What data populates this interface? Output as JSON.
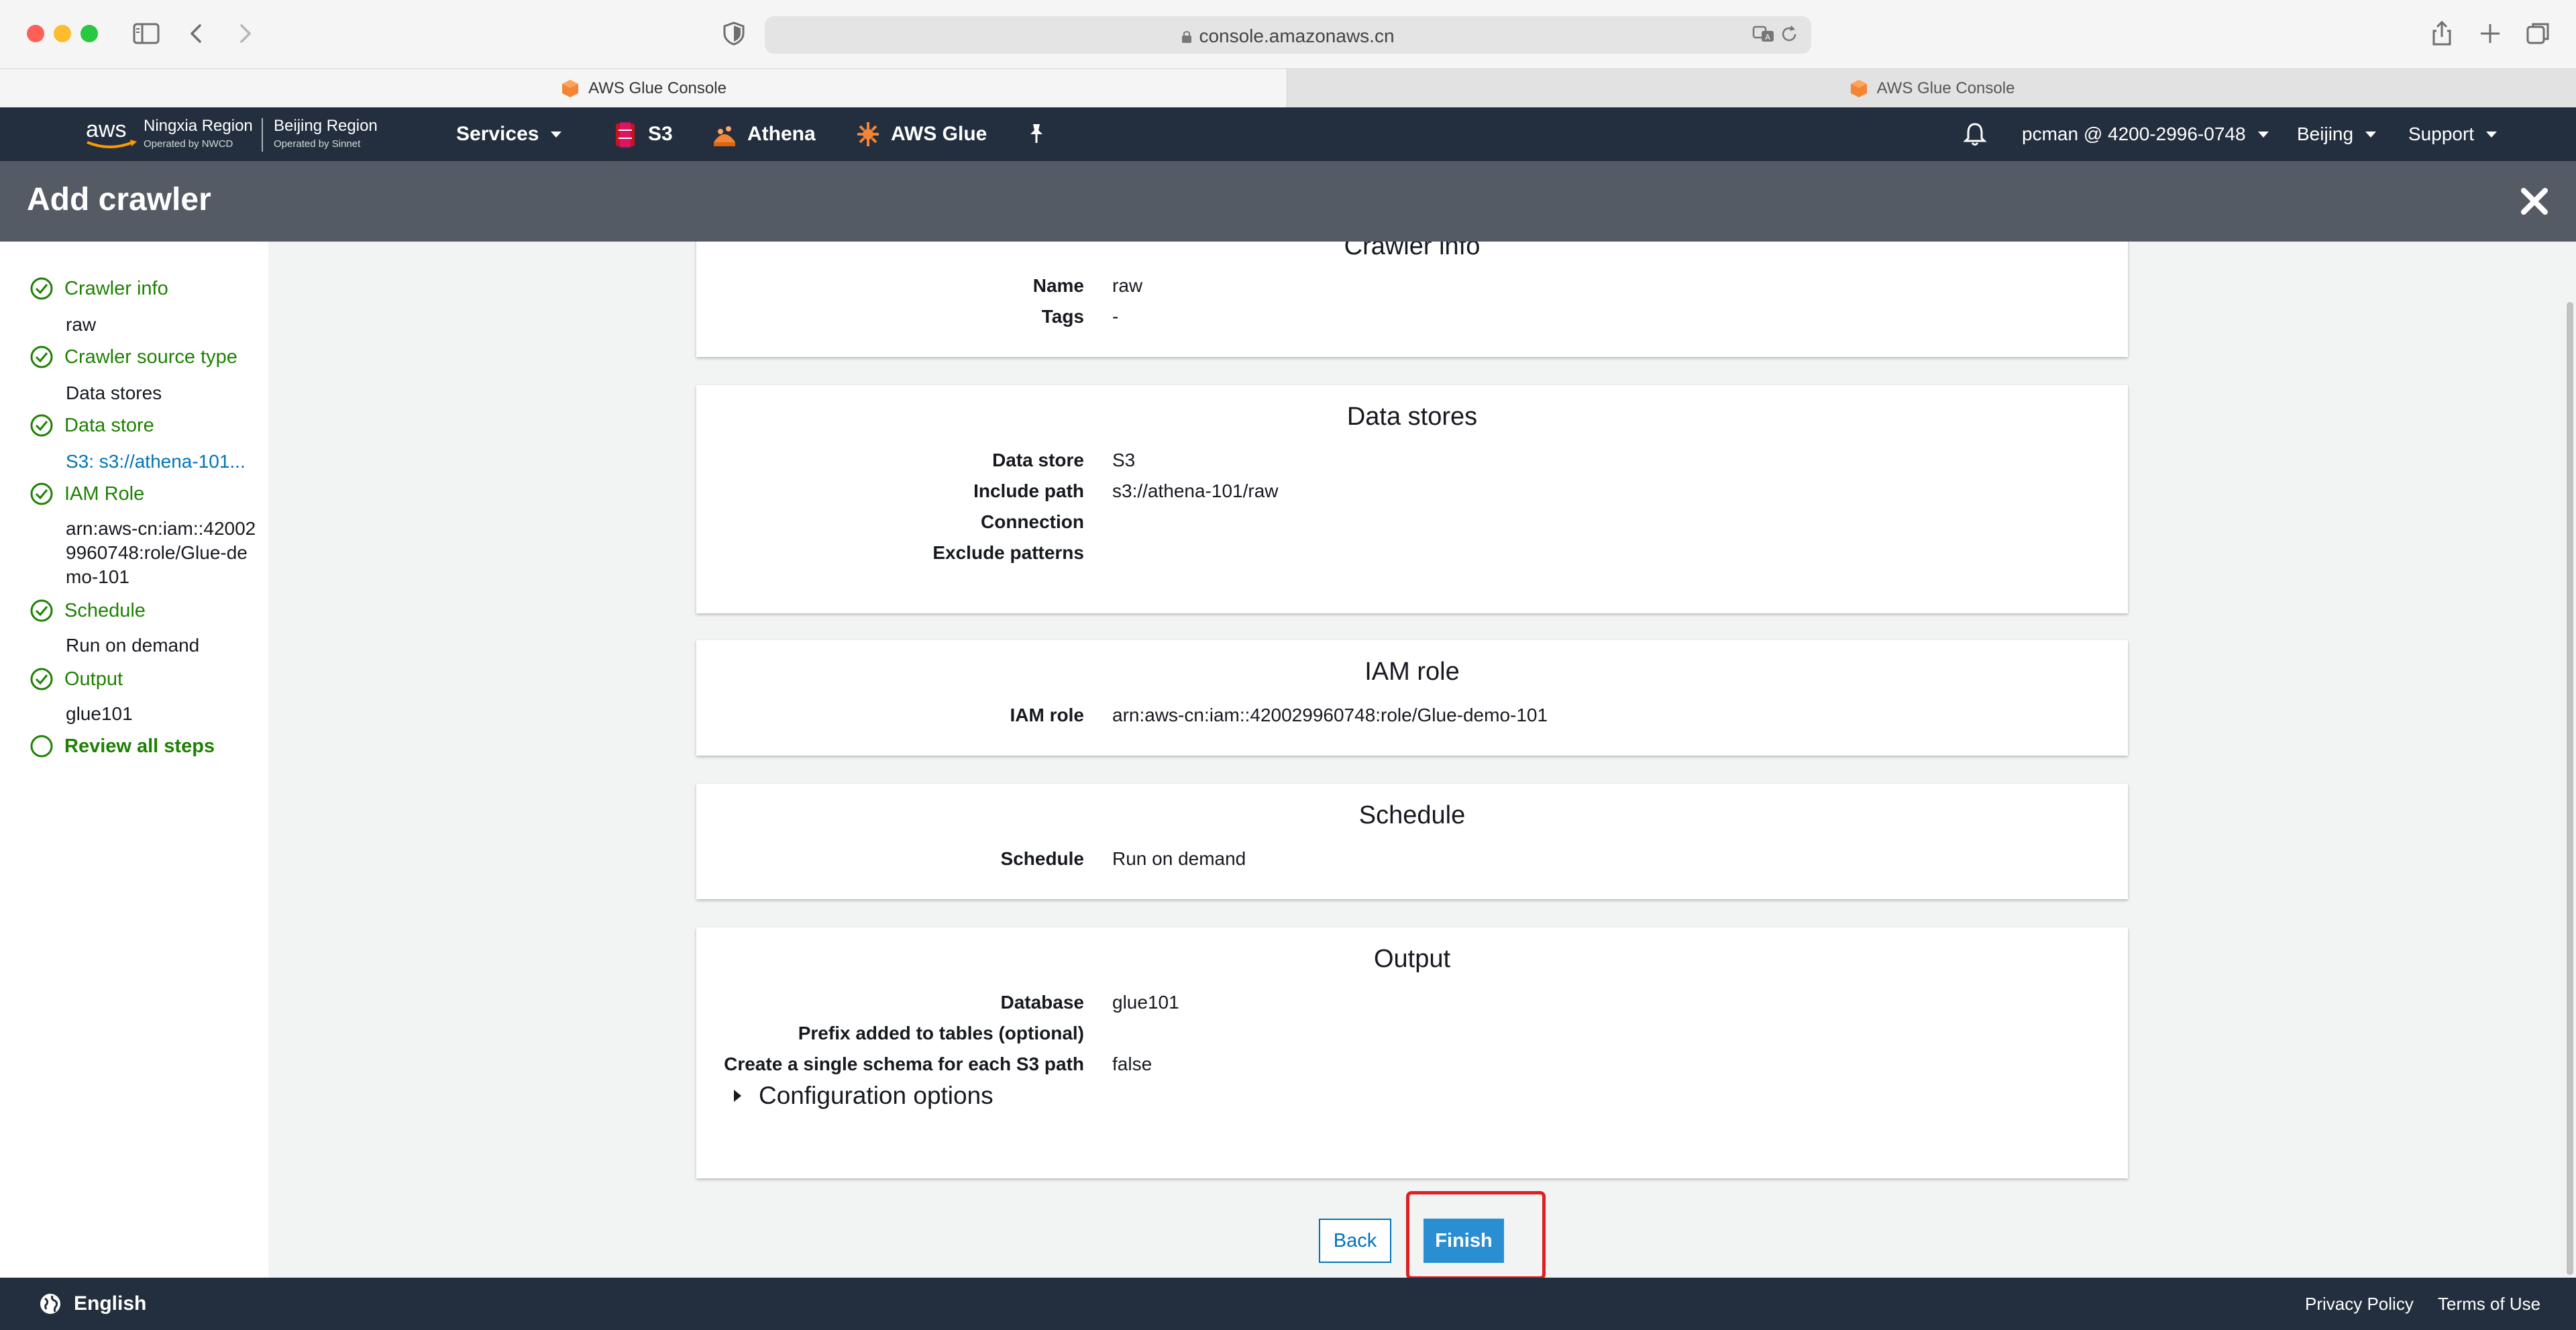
{
  "browser": {
    "url": "console.amazonaws.cn",
    "tabs": [
      {
        "label": "AWS Glue Console"
      },
      {
        "label": "AWS Glue Console"
      }
    ]
  },
  "nav": {
    "region_1": {
      "name": "Ningxia Region",
      "operator": "Operated by NWCD"
    },
    "region_2": {
      "name": "Beijing Region",
      "operator": "Operated by Sinnet"
    },
    "services": "Services",
    "s3": "S3",
    "athena": "Athena",
    "glue": "AWS Glue",
    "account": "pcman @ 4200-2996-0748",
    "region": "Beijing",
    "support": "Support"
  },
  "page": {
    "title": "Add crawler"
  },
  "sidebar": {
    "steps": [
      {
        "label": "Crawler info",
        "value": "raw",
        "done": true
      },
      {
        "label": "Crawler source type",
        "value": "Data stores",
        "done": true
      },
      {
        "label": "Data store",
        "value": "S3: s3://athena-101...",
        "done": true
      },
      {
        "label": "IAM Role",
        "value": "arn:aws-cn:iam::420029960748:role/Glue-demo-101",
        "done": true
      },
      {
        "label": "Schedule",
        "value": "Run on demand",
        "done": true
      },
      {
        "label": "Output",
        "value": "glue101",
        "done": true
      },
      {
        "label": "Review all steps",
        "value": "",
        "done": false
      }
    ]
  },
  "review": {
    "crawler_info": {
      "title": "Crawler info",
      "name_label": "Name",
      "name_value": "raw",
      "tags_label": "Tags",
      "tags_value": "-"
    },
    "data_stores": {
      "title": "Data stores",
      "data_store_label": "Data store",
      "data_store_value": "S3",
      "include_path_label": "Include path",
      "include_path_value": "s3://athena-101/raw",
      "connection_label": "Connection",
      "connection_value": "",
      "exclude_label": "Exclude patterns",
      "exclude_value": ""
    },
    "iam_role": {
      "title": "IAM role",
      "label": "IAM role",
      "value": "arn:aws-cn:iam::420029960748:role/Glue-demo-101"
    },
    "schedule": {
      "title": "Schedule",
      "label": "Schedule",
      "value": "Run on demand"
    },
    "output": {
      "title": "Output",
      "database_label": "Database",
      "database_value": "glue101",
      "prefix_label": "Prefix added to tables (optional)",
      "prefix_value": "",
      "single_schema_label": "Create a single schema for each S3 path",
      "single_schema_value": "false",
      "config_options": "Configuration options"
    }
  },
  "actions": {
    "back": "Back",
    "finish": "Finish"
  },
  "footer": {
    "language": "English",
    "privacy": "Privacy Policy",
    "terms": "Terms of Use"
  },
  "colors": {
    "nav_bg": "#232f3e",
    "header_bg": "#545b64",
    "step_green": "#1d8102",
    "link_blue": "#0073bb",
    "primary_button": "#2a8fd2",
    "highlight_red": "#e02020"
  },
  "icons": {
    "sidebar_toggle": "sidebar-icon",
    "back": "chevron-left-icon",
    "forward": "chevron-right-icon",
    "shield": "shield-icon",
    "lock": "lock-icon",
    "translate": "translate-icon",
    "reload": "reload-icon",
    "share": "share-icon",
    "new_tab": "plus-icon",
    "tabs_overview": "tabs-icon",
    "pin": "pin-icon",
    "bell": "bell-icon",
    "close": "close-icon",
    "step_done": "check-circle-icon",
    "step_pending": "empty-circle-icon",
    "globe": "globe-icon"
  }
}
